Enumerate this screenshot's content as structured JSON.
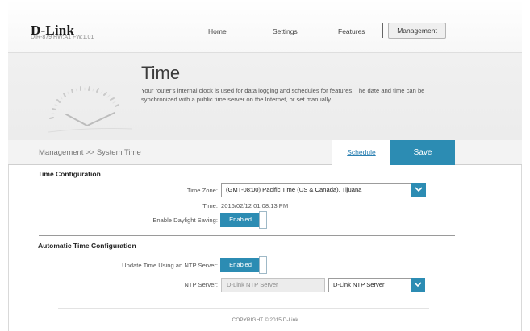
{
  "header": {
    "brand": "D-Link",
    "model_info": "DIR-879 HW:A1 FW:1.01",
    "nav": [
      {
        "label": "Home"
      },
      {
        "label": "Settings"
      },
      {
        "label": "Features"
      },
      {
        "label": "Management",
        "active": true
      }
    ]
  },
  "banner": {
    "title": "Time",
    "description": "Your router's internal clock is used for data logging and schedules for features. The date and time can be synchronized with a public time server on the Internet, or set manually.",
    "icon": "clock-icon"
  },
  "toolbar": {
    "breadcrumb": "Management >> System Time",
    "schedule_label": "Schedule",
    "save_label": "Save"
  },
  "time_config": {
    "section_title": "Time Configuration",
    "timezone_label": "Time Zone:",
    "timezone_value": "(GMT-08:00) Pacific Time (US & Canada), Tijuana",
    "time_label": "Time:",
    "time_value": "2016/02/12 01:08:13 PM",
    "dst_label": "Enable Daylight Saving:",
    "dst_value": "Enabled"
  },
  "auto_time": {
    "section_title": "Automatic Time Configuration",
    "ntp_update_label": "Update Time Using an NTP Server:",
    "ntp_update_value": "Enabled",
    "ntp_server_label": "NTP Server:",
    "ntp_server_placeholder": "D-Link NTP Server",
    "ntp_server_select": "D-Link NTP Server"
  },
  "footer": {
    "copyright": "COPYRIGHT © 2015 D-Link"
  },
  "colors": {
    "accent": "#2c8cb3",
    "link": "#2a7fb1",
    "banner_bg": "#eeeeee"
  }
}
